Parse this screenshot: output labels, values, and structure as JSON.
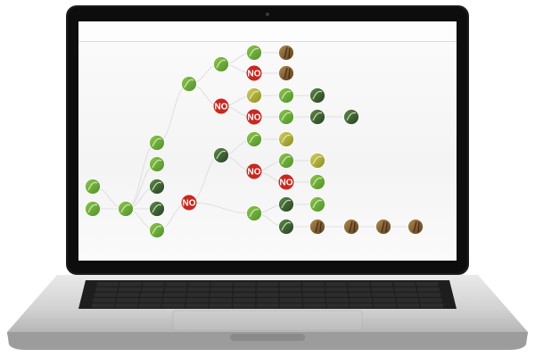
{
  "device": "laptop",
  "app": {
    "view": "decision-tree",
    "no_label": "NO"
  },
  "palette": {
    "no_badge": "#c8281f",
    "link_line": "#d9d9d9",
    "leaf_green": "#6fae3c",
    "dark_green": "#2f6b2e",
    "yellow_green": "#b7b52f",
    "brown": "#7a5a2a"
  },
  "tree": {
    "nodes": [
      {
        "id": "n1",
        "kind": "photo",
        "tone": "leaf_green",
        "icon": "leaf-photo-icon"
      },
      {
        "id": "n2",
        "kind": "photo",
        "tone": "leaf_green",
        "icon": "leaf-photo-icon"
      },
      {
        "id": "n3",
        "kind": "photo",
        "tone": "leaf_green",
        "icon": "leaf-photo-icon"
      },
      {
        "id": "n4",
        "kind": "photo",
        "tone": "leaf_green",
        "icon": "leaf-photo-icon"
      },
      {
        "id": "n5",
        "kind": "photo",
        "tone": "leaf_green",
        "icon": "leaf-photo-icon"
      },
      {
        "id": "n6",
        "kind": "photo",
        "tone": "dark_green",
        "icon": "leaf-photo-icon"
      },
      {
        "id": "n7",
        "kind": "photo",
        "tone": "dark_green",
        "icon": "leaf-photo-icon"
      },
      {
        "id": "n8",
        "kind": "photo",
        "tone": "leaf_green",
        "icon": "leaf-photo-icon"
      },
      {
        "id": "n9",
        "kind": "no"
      },
      {
        "id": "n10",
        "kind": "photo",
        "tone": "leaf_green",
        "icon": "leaf-photo-icon"
      },
      {
        "id": "n11",
        "kind": "photo",
        "tone": "leaf_green",
        "icon": "leaf-photo-icon"
      },
      {
        "id": "n12",
        "kind": "no"
      },
      {
        "id": "n13",
        "kind": "photo",
        "tone": "leaf_green",
        "icon": "leaf-photo-icon"
      },
      {
        "id": "n14",
        "kind": "photo",
        "tone": "brown",
        "icon": "stem-photo-icon"
      },
      {
        "id": "n15",
        "kind": "no"
      },
      {
        "id": "n16",
        "kind": "photo",
        "tone": "brown",
        "icon": "stem-photo-icon"
      },
      {
        "id": "n17",
        "kind": "photo",
        "tone": "yellow_green",
        "icon": "leaf-photo-icon"
      },
      {
        "id": "n18",
        "kind": "photo",
        "tone": "leaf_green",
        "icon": "leaf-photo-icon"
      },
      {
        "id": "n19",
        "kind": "photo",
        "tone": "dark_green",
        "icon": "leaf-photo-icon"
      },
      {
        "id": "n20",
        "kind": "no"
      },
      {
        "id": "n21",
        "kind": "photo",
        "tone": "leaf_green",
        "icon": "leaf-photo-icon"
      },
      {
        "id": "n22",
        "kind": "photo",
        "tone": "dark_green",
        "icon": "leaf-photo-icon"
      },
      {
        "id": "n23",
        "kind": "photo",
        "tone": "dark_green",
        "icon": "leaf-photo-icon"
      },
      {
        "id": "n24",
        "kind": "photo",
        "tone": "leaf_green",
        "icon": "leaf-photo-icon"
      },
      {
        "id": "n25",
        "kind": "photo",
        "tone": "yellow_green",
        "icon": "leaf-photo-icon"
      },
      {
        "id": "n26",
        "kind": "no"
      },
      {
        "id": "n27",
        "kind": "photo",
        "tone": "leaf_green",
        "icon": "leaf-photo-icon"
      },
      {
        "id": "n28",
        "kind": "photo",
        "tone": "yellow_green",
        "icon": "leaf-photo-icon"
      },
      {
        "id": "n29",
        "kind": "no"
      },
      {
        "id": "n30",
        "kind": "photo",
        "tone": "leaf_green",
        "icon": "leaf-photo-icon"
      },
      {
        "id": "n31",
        "kind": "photo",
        "tone": "leaf_green",
        "icon": "leaf-photo-icon"
      },
      {
        "id": "n32",
        "kind": "photo",
        "tone": "dark_green",
        "icon": "leaf-photo-icon"
      },
      {
        "id": "n33",
        "kind": "no"
      },
      {
        "id": "n34",
        "kind": "photo",
        "tone": "brown",
        "icon": "stem-photo-icon"
      },
      {
        "id": "n35",
        "kind": "photo",
        "tone": "brown",
        "icon": "stem-photo-icon"
      },
      {
        "id": "n36",
        "kind": "photo",
        "tone": "brown",
        "icon": "stem-photo-icon"
      },
      {
        "id": "n37",
        "kind": "photo",
        "tone": "brown",
        "icon": "stem-photo-icon"
      },
      {
        "id": "n38",
        "kind": "photo",
        "tone": "dark_green",
        "icon": "leaf-photo-icon"
      },
      {
        "id": "n39",
        "kind": "photo",
        "tone": "leaf_green",
        "icon": "leaf-photo-icon"
      },
      {
        "id": "n40",
        "kind": "photo",
        "tone": "dark_green",
        "icon": "leaf-photo-icon"
      }
    ]
  }
}
